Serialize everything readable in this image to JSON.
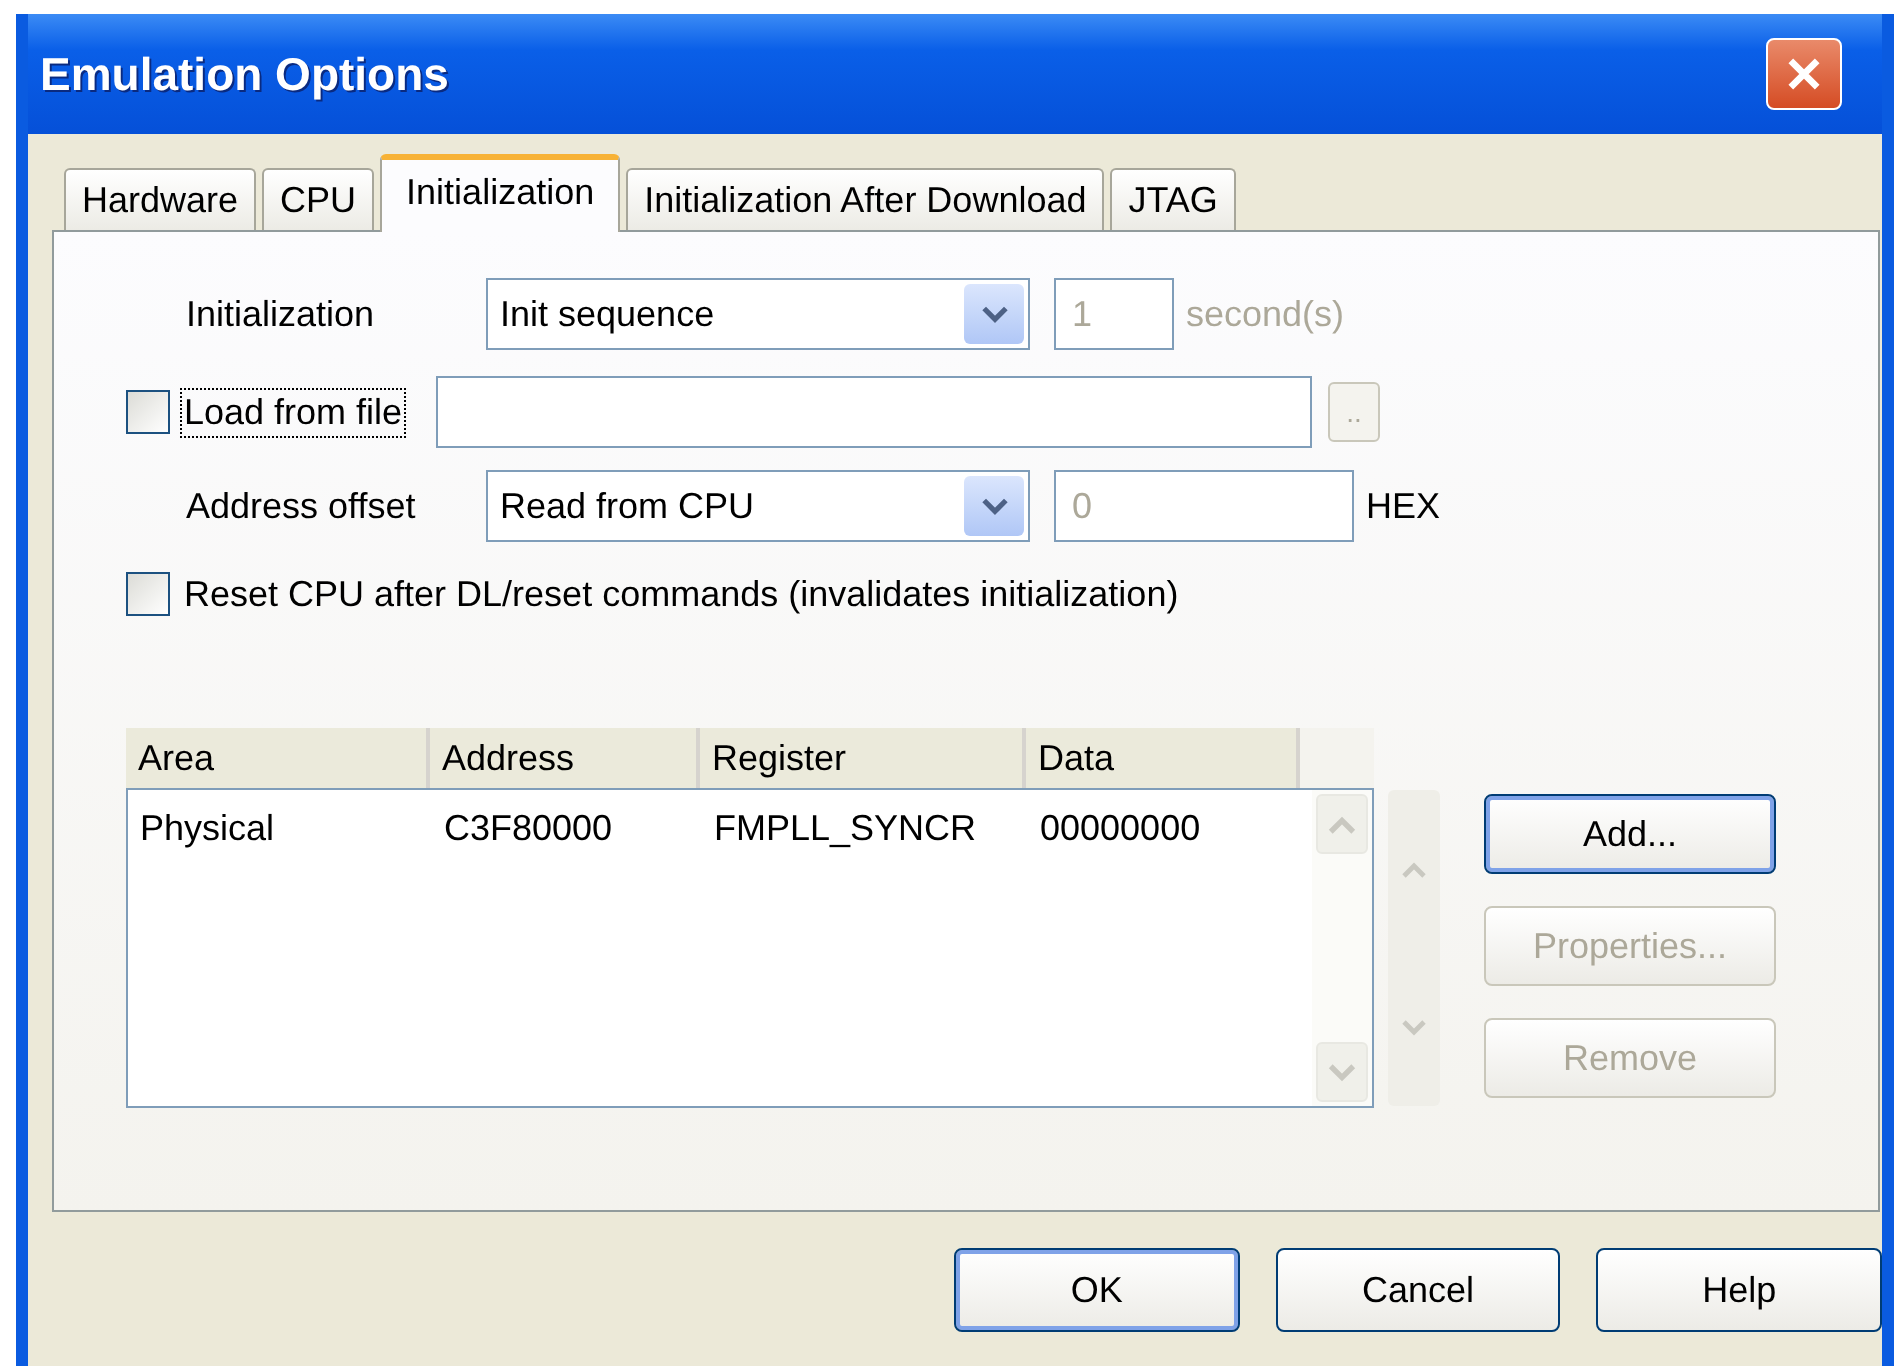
{
  "window": {
    "title": "Emulation Options"
  },
  "tabs": [
    {
      "label": "Hardware",
      "selected": false
    },
    {
      "label": "CPU",
      "selected": false
    },
    {
      "label": "Initialization",
      "selected": true
    },
    {
      "label": "Initialization After Download",
      "selected": false
    },
    {
      "label": "JTAG",
      "selected": false
    }
  ],
  "initialization": {
    "label": "Initialization",
    "value": "Init sequence",
    "timeout": {
      "value": "1",
      "disabled": true
    },
    "unit": "second(s)",
    "unit_disabled": true
  },
  "load_from_file": {
    "label": "Load from file",
    "checked": false,
    "focused": true,
    "browse_button": {
      "label": "..",
      "disabled": true
    }
  },
  "address_offset": {
    "label": "Address offset",
    "value": "Read from CPU",
    "offset": {
      "value": "0",
      "disabled": true
    },
    "unit": "HEX",
    "unit_disabled": false
  },
  "reset_cpu": {
    "label": "Reset CPU after DL/reset commands (invalidates initialization)",
    "checked": false
  },
  "table": {
    "columns": [
      "Area",
      "Address",
      "Register",
      "Data"
    ],
    "rows": [
      [
        "Physical",
        "C3F80000",
        "FMPLL_SYNCR",
        "00000000"
      ]
    ]
  },
  "side_buttons": [
    {
      "label": "Add...",
      "disabled": false,
      "default": true
    },
    {
      "label": "Properties...",
      "disabled": true,
      "default": false
    },
    {
      "label": "Remove",
      "disabled": true,
      "default": false
    }
  ],
  "buttons": [
    {
      "label": "OK",
      "default": true
    },
    {
      "label": "Cancel",
      "default": false
    },
    {
      "label": "Help",
      "default": false
    }
  ]
}
